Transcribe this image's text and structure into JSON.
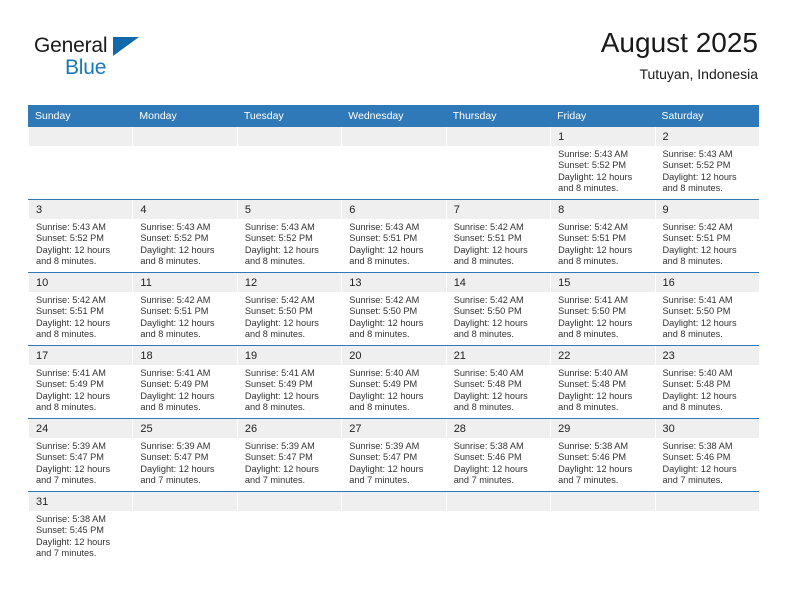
{
  "brand": {
    "name_top": "General",
    "name_bottom": "Blue",
    "accent_color": "#1878be",
    "flag_color": "#1169ab"
  },
  "header": {
    "title": "August 2025",
    "subtitle": "Tutuyan, Indonesia"
  },
  "theme": {
    "header_bar_color": "#3079b8",
    "day_band_color": "#efefef",
    "row_divider_color": "#3079b8"
  },
  "weekday_headers": [
    "Sunday",
    "Monday",
    "Tuesday",
    "Wednesday",
    "Thursday",
    "Friday",
    "Saturday"
  ],
  "labels": {
    "sunrise_prefix": "Sunrise:",
    "sunset_prefix": "Sunset:",
    "daylight_prefix": "Daylight:"
  },
  "weeks": [
    [
      {
        "day": "",
        "blank": true
      },
      {
        "day": "",
        "blank": true
      },
      {
        "day": "",
        "blank": true
      },
      {
        "day": "",
        "blank": true
      },
      {
        "day": "",
        "blank": true
      },
      {
        "day": "1",
        "sunrise": "Sunrise: 5:43 AM",
        "sunset": "Sunset: 5:52 PM",
        "daylight_l1": "Daylight: 12 hours",
        "daylight_l2": "and 8 minutes."
      },
      {
        "day": "2",
        "sunrise": "Sunrise: 5:43 AM",
        "sunset": "Sunset: 5:52 PM",
        "daylight_l1": "Daylight: 12 hours",
        "daylight_l2": "and 8 minutes."
      }
    ],
    [
      {
        "day": "3",
        "sunrise": "Sunrise: 5:43 AM",
        "sunset": "Sunset: 5:52 PM",
        "daylight_l1": "Daylight: 12 hours",
        "daylight_l2": "and 8 minutes."
      },
      {
        "day": "4",
        "sunrise": "Sunrise: 5:43 AM",
        "sunset": "Sunset: 5:52 PM",
        "daylight_l1": "Daylight: 12 hours",
        "daylight_l2": "and 8 minutes."
      },
      {
        "day": "5",
        "sunrise": "Sunrise: 5:43 AM",
        "sunset": "Sunset: 5:52 PM",
        "daylight_l1": "Daylight: 12 hours",
        "daylight_l2": "and 8 minutes."
      },
      {
        "day": "6",
        "sunrise": "Sunrise: 5:43 AM",
        "sunset": "Sunset: 5:51 PM",
        "daylight_l1": "Daylight: 12 hours",
        "daylight_l2": "and 8 minutes."
      },
      {
        "day": "7",
        "sunrise": "Sunrise: 5:42 AM",
        "sunset": "Sunset: 5:51 PM",
        "daylight_l1": "Daylight: 12 hours",
        "daylight_l2": "and 8 minutes."
      },
      {
        "day": "8",
        "sunrise": "Sunrise: 5:42 AM",
        "sunset": "Sunset: 5:51 PM",
        "daylight_l1": "Daylight: 12 hours",
        "daylight_l2": "and 8 minutes."
      },
      {
        "day": "9",
        "sunrise": "Sunrise: 5:42 AM",
        "sunset": "Sunset: 5:51 PM",
        "daylight_l1": "Daylight: 12 hours",
        "daylight_l2": "and 8 minutes."
      }
    ],
    [
      {
        "day": "10",
        "sunrise": "Sunrise: 5:42 AM",
        "sunset": "Sunset: 5:51 PM",
        "daylight_l1": "Daylight: 12 hours",
        "daylight_l2": "and 8 minutes."
      },
      {
        "day": "11",
        "sunrise": "Sunrise: 5:42 AM",
        "sunset": "Sunset: 5:51 PM",
        "daylight_l1": "Daylight: 12 hours",
        "daylight_l2": "and 8 minutes."
      },
      {
        "day": "12",
        "sunrise": "Sunrise: 5:42 AM",
        "sunset": "Sunset: 5:50 PM",
        "daylight_l1": "Daylight: 12 hours",
        "daylight_l2": "and 8 minutes."
      },
      {
        "day": "13",
        "sunrise": "Sunrise: 5:42 AM",
        "sunset": "Sunset: 5:50 PM",
        "daylight_l1": "Daylight: 12 hours",
        "daylight_l2": "and 8 minutes."
      },
      {
        "day": "14",
        "sunrise": "Sunrise: 5:42 AM",
        "sunset": "Sunset: 5:50 PM",
        "daylight_l1": "Daylight: 12 hours",
        "daylight_l2": "and 8 minutes."
      },
      {
        "day": "15",
        "sunrise": "Sunrise: 5:41 AM",
        "sunset": "Sunset: 5:50 PM",
        "daylight_l1": "Daylight: 12 hours",
        "daylight_l2": "and 8 minutes."
      },
      {
        "day": "16",
        "sunrise": "Sunrise: 5:41 AM",
        "sunset": "Sunset: 5:50 PM",
        "daylight_l1": "Daylight: 12 hours",
        "daylight_l2": "and 8 minutes."
      }
    ],
    [
      {
        "day": "17",
        "sunrise": "Sunrise: 5:41 AM",
        "sunset": "Sunset: 5:49 PM",
        "daylight_l1": "Daylight: 12 hours",
        "daylight_l2": "and 8 minutes."
      },
      {
        "day": "18",
        "sunrise": "Sunrise: 5:41 AM",
        "sunset": "Sunset: 5:49 PM",
        "daylight_l1": "Daylight: 12 hours",
        "daylight_l2": "and 8 minutes."
      },
      {
        "day": "19",
        "sunrise": "Sunrise: 5:41 AM",
        "sunset": "Sunset: 5:49 PM",
        "daylight_l1": "Daylight: 12 hours",
        "daylight_l2": "and 8 minutes."
      },
      {
        "day": "20",
        "sunrise": "Sunrise: 5:40 AM",
        "sunset": "Sunset: 5:49 PM",
        "daylight_l1": "Daylight: 12 hours",
        "daylight_l2": "and 8 minutes."
      },
      {
        "day": "21",
        "sunrise": "Sunrise: 5:40 AM",
        "sunset": "Sunset: 5:48 PM",
        "daylight_l1": "Daylight: 12 hours",
        "daylight_l2": "and 8 minutes."
      },
      {
        "day": "22",
        "sunrise": "Sunrise: 5:40 AM",
        "sunset": "Sunset: 5:48 PM",
        "daylight_l1": "Daylight: 12 hours",
        "daylight_l2": "and 8 minutes."
      },
      {
        "day": "23",
        "sunrise": "Sunrise: 5:40 AM",
        "sunset": "Sunset: 5:48 PM",
        "daylight_l1": "Daylight: 12 hours",
        "daylight_l2": "and 8 minutes."
      }
    ],
    [
      {
        "day": "24",
        "sunrise": "Sunrise: 5:39 AM",
        "sunset": "Sunset: 5:47 PM",
        "daylight_l1": "Daylight: 12 hours",
        "daylight_l2": "and 7 minutes."
      },
      {
        "day": "25",
        "sunrise": "Sunrise: 5:39 AM",
        "sunset": "Sunset: 5:47 PM",
        "daylight_l1": "Daylight: 12 hours",
        "daylight_l2": "and 7 minutes."
      },
      {
        "day": "26",
        "sunrise": "Sunrise: 5:39 AM",
        "sunset": "Sunset: 5:47 PM",
        "daylight_l1": "Daylight: 12 hours",
        "daylight_l2": "and 7 minutes."
      },
      {
        "day": "27",
        "sunrise": "Sunrise: 5:39 AM",
        "sunset": "Sunset: 5:47 PM",
        "daylight_l1": "Daylight: 12 hours",
        "daylight_l2": "and 7 minutes."
      },
      {
        "day": "28",
        "sunrise": "Sunrise: 5:38 AM",
        "sunset": "Sunset: 5:46 PM",
        "daylight_l1": "Daylight: 12 hours",
        "daylight_l2": "and 7 minutes."
      },
      {
        "day": "29",
        "sunrise": "Sunrise: 5:38 AM",
        "sunset": "Sunset: 5:46 PM",
        "daylight_l1": "Daylight: 12 hours",
        "daylight_l2": "and 7 minutes."
      },
      {
        "day": "30",
        "sunrise": "Sunrise: 5:38 AM",
        "sunset": "Sunset: 5:46 PM",
        "daylight_l1": "Daylight: 12 hours",
        "daylight_l2": "and 7 minutes."
      }
    ],
    [
      {
        "day": "31",
        "sunrise": "Sunrise: 5:38 AM",
        "sunset": "Sunset: 5:45 PM",
        "daylight_l1": "Daylight: 12 hours",
        "daylight_l2": "and 7 minutes."
      },
      {
        "day": "",
        "blank": true
      },
      {
        "day": "",
        "blank": true
      },
      {
        "day": "",
        "blank": true
      },
      {
        "day": "",
        "blank": true
      },
      {
        "day": "",
        "blank": true
      },
      {
        "day": "",
        "blank": true
      }
    ]
  ]
}
